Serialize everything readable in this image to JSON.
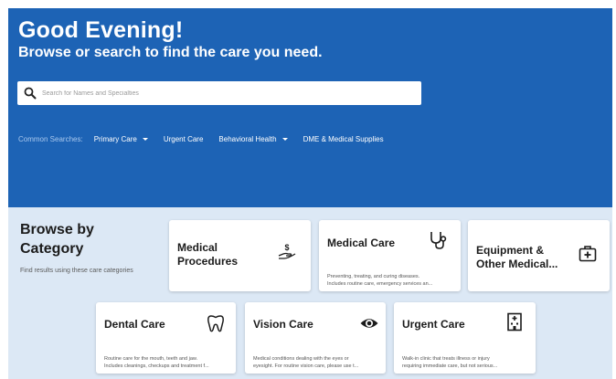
{
  "hero": {
    "greeting": "Good Evening!",
    "subtitle": "Browse or search to find the care you need.",
    "search_placeholder": "Search for Names and Specialties"
  },
  "common_searches": {
    "label": "Common Searches:",
    "links": [
      {
        "label": "Primary Care",
        "dropdown": true
      },
      {
        "label": "Urgent Care",
        "dropdown": false
      },
      {
        "label": "Behavioral Health",
        "dropdown": true
      },
      {
        "label": "DME & Medical Supplies",
        "dropdown": false
      }
    ]
  },
  "browse": {
    "title_line1": "Browse by",
    "title_line2": "Category",
    "subtitle": "Find results using these care categories"
  },
  "categories": [
    {
      "title_line1": "Medical",
      "title_line2": "Procedures",
      "description_line1": "",
      "description_line2": "",
      "icon": "hand-dollar-icon"
    },
    {
      "title_line1": "Medical Care",
      "title_line2": "",
      "description_line1": "Preventing, treating, and curing diseases.",
      "description_line2": "Includes routine care, emergency services an...",
      "icon": "stethoscope-icon"
    },
    {
      "title_line1": "Equipment &",
      "title_line2": "Other Medical...",
      "description_line1": "",
      "description_line2": "",
      "icon": "medical-kit-icon"
    },
    {
      "title_line1": "Dental Care",
      "title_line2": "",
      "description_line1": "Routine care for the mouth, teeth and jaw.",
      "description_line2": "Includes cleanings, checkups and treatment f...",
      "icon": "tooth-icon"
    },
    {
      "title_line1": "Vision Care",
      "title_line2": "",
      "description_line1": "Medical conditions dealing with the eyes or",
      "description_line2": "eyesight. For routine vision care, please use t...",
      "icon": "eye-icon"
    },
    {
      "title_line1": "Urgent Care",
      "title_line2": "",
      "description_line1": "Walk-in clinic that treats illness or injury",
      "description_line2": "requiring immediate care, but not serious...",
      "icon": "hospital-icon"
    }
  ],
  "colors": {
    "hero_blue": "#1d63b5",
    "page_bg": "#dce8f5",
    "common_label": "#a9c8ee"
  }
}
